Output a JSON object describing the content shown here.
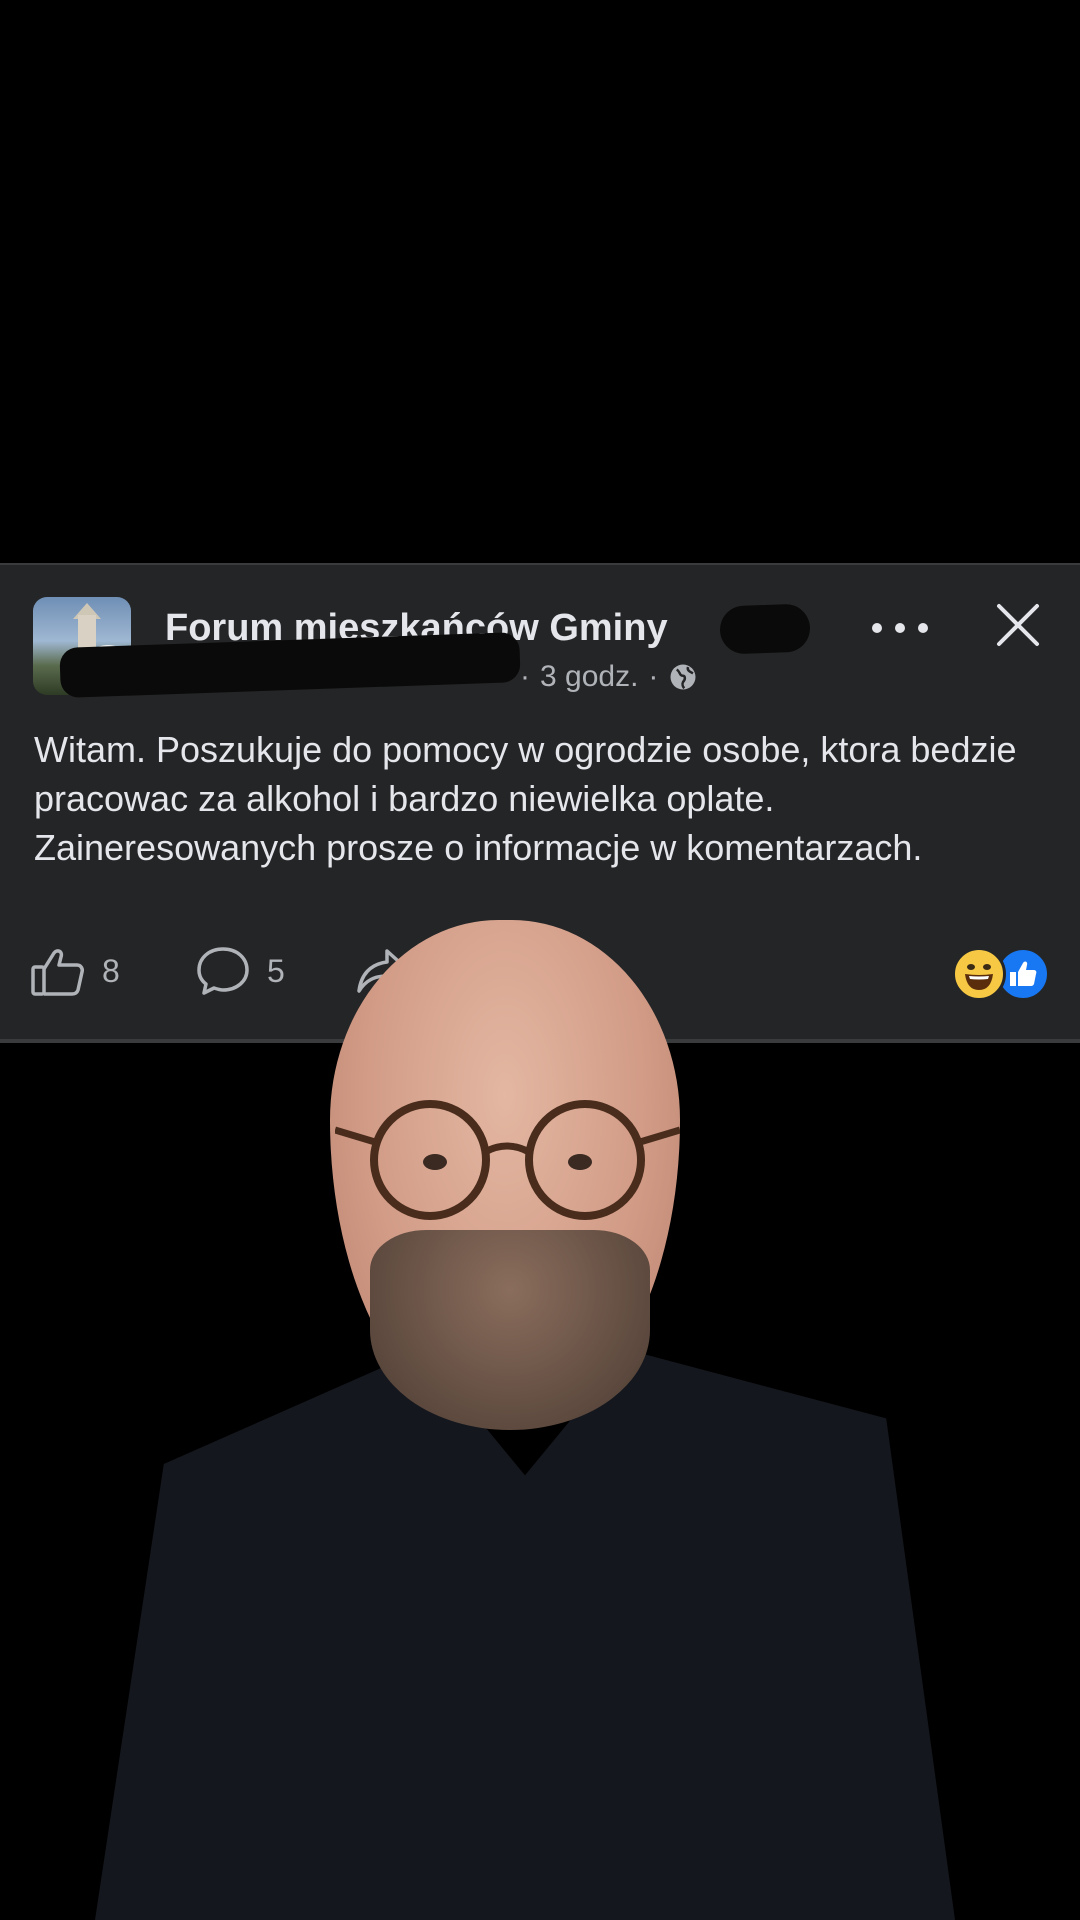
{
  "post": {
    "group_name": "Forum mieszkańców Gminy",
    "time": "3 godz.",
    "separator": "·",
    "body": "Witam. Poszukuje do pomocy w ogrodzie osobe, ktora bedzie pracowac za alkohol i bardzo niewielka oplate. Zaineresowanych prosze o informacje w komentarzach.",
    "likes_count": "8",
    "comments_count": "5"
  },
  "icons": {
    "avatar": "group-avatar",
    "privacy": "globe-icon",
    "more": "more-icon",
    "close": "close-icon",
    "like": "thumbs-up-icon",
    "comment": "comment-bubble-icon",
    "share": "share-arrow-icon",
    "reaction_1": "haha-reaction-icon",
    "reaction_2": "like-reaction-icon"
  },
  "colors": {
    "card_bg": "#242526",
    "primary_text": "#e4e6eb",
    "secondary_text": "#b0b3b8",
    "like_blue": "#1877f2",
    "haha_yellow": "#f7c843"
  }
}
